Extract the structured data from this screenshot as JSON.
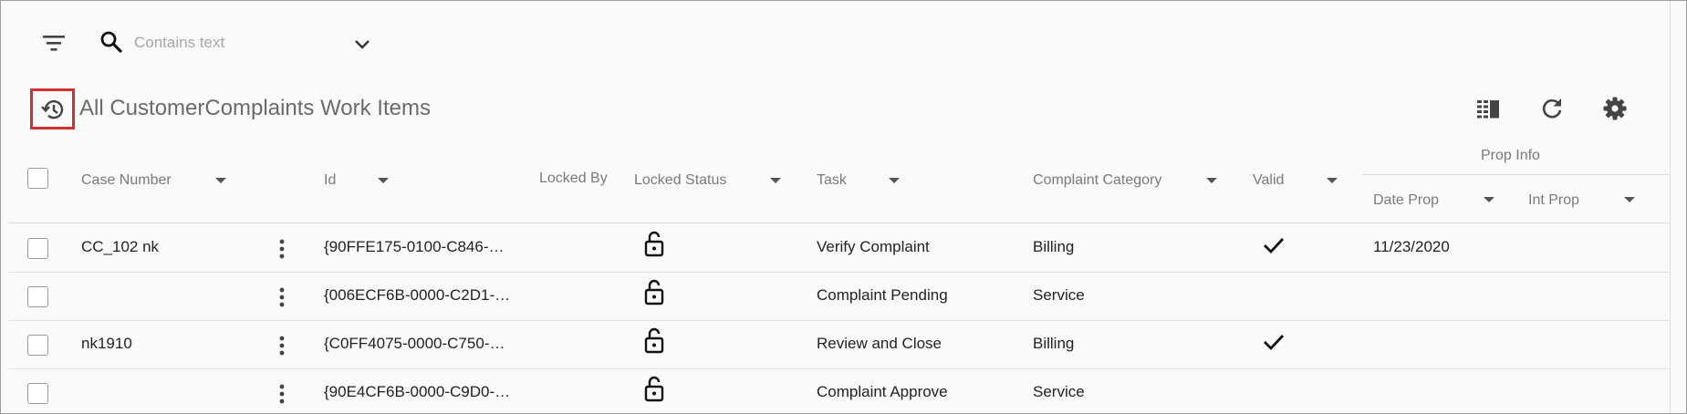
{
  "toolbar": {
    "search_placeholder": "Contains text",
    "icons": [
      "filter-list-icon",
      "search-icon",
      "chevron-down-icon"
    ]
  },
  "header": {
    "title": "All CustomerComplaints Work Items",
    "icons": [
      "history-icon",
      "column-chooser-icon",
      "refresh-icon",
      "settings-icon"
    ]
  },
  "table": {
    "columns": {
      "case_number": "Case Number",
      "id": "Id",
      "locked_by": "Locked By",
      "locked_status": "Locked Status",
      "task": "Task",
      "complaint_category": "Complaint Category",
      "valid": "Valid",
      "group_prop_info": "Prop Info",
      "date_prop": "Date Prop",
      "int_prop": "Int Prop"
    },
    "rows": [
      {
        "case_number": "CC_102 nk",
        "id": "{90FFE175-0100-C846-…",
        "locked_status": "unlocked",
        "task": "Verify Complaint",
        "complaint_category": "Billing",
        "valid": true,
        "date_prop": "11/23/2020",
        "int_prop": ""
      },
      {
        "case_number": "",
        "id": "{006ECF6B-0000-C2D1-…",
        "locked_status": "unlocked",
        "task": "Complaint Pending",
        "complaint_category": "Service",
        "valid": false,
        "date_prop": "",
        "int_prop": ""
      },
      {
        "case_number": "nk1910",
        "id": "{C0FF4075-0000-C750-…",
        "locked_status": "unlocked",
        "task": "Review and Close",
        "complaint_category": "Billing",
        "valid": true,
        "date_prop": "",
        "int_prop": ""
      },
      {
        "case_number": "",
        "id": "{90E4CF6B-0000-C9D0-…",
        "locked_status": "unlocked",
        "task": "Complaint Approve",
        "complaint_category": "Service",
        "valid": false,
        "date_prop": "",
        "int_prop": ""
      }
    ]
  },
  "colors": {
    "highlight_border": "#d32f2f",
    "header_text": "#7a7a7a",
    "title_text": "#6b6b6b",
    "icon": "#444444"
  }
}
